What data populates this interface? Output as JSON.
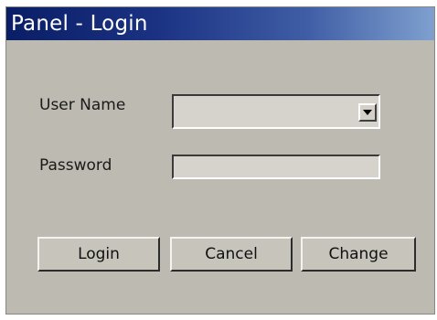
{
  "window": {
    "title": "Panel - Login"
  },
  "form": {
    "user_name_label": "User Name",
    "user_name_value": "",
    "password_label": "Password",
    "password_value": ""
  },
  "buttons": {
    "login": "Login",
    "cancel": "Cancel",
    "change": "Change"
  },
  "icons": {
    "dropdown": "chevron-down-icon"
  },
  "colors": {
    "title_bar_start": "#0a1e66",
    "title_bar_end": "#7fa0cf",
    "panel_background": "#bdbab1"
  }
}
